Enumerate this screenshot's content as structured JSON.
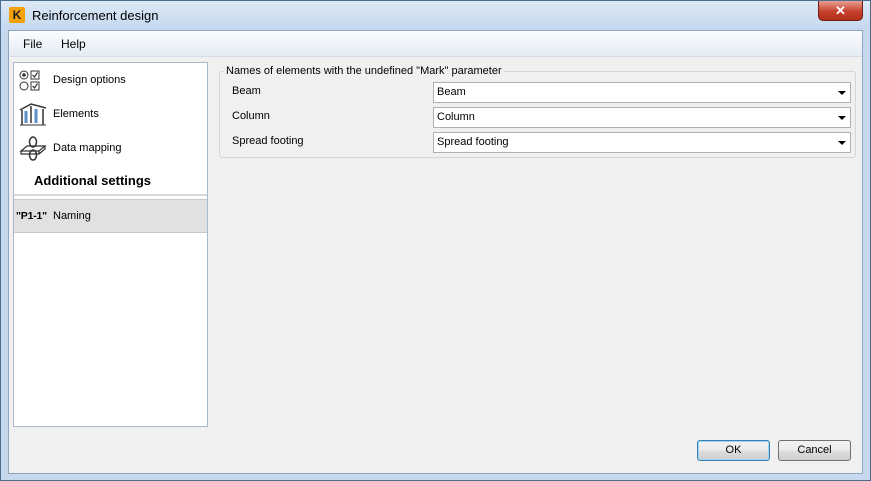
{
  "window": {
    "title": "Reinforcement design",
    "icon_letter": "K",
    "close_glyph": "✕"
  },
  "menu": [
    "File",
    "Help"
  ],
  "sidebar": {
    "items": [
      {
        "label": "Design options",
        "icon": "design-options-icon"
      },
      {
        "label": "Elements",
        "icon": "elements-icon"
      },
      {
        "label": "Data mapping",
        "icon": "data-mapping-icon"
      }
    ],
    "section_title": "Additional settings",
    "selected_item": {
      "badge": "\"P1-1\"",
      "label": "Naming"
    }
  },
  "group": {
    "legend": "Names of elements with the undefined \"Mark\" parameter",
    "rows": [
      {
        "label": "Beam",
        "value": "Beam"
      },
      {
        "label": "Column",
        "value": "Column"
      },
      {
        "label": "Spread footing",
        "value": "Spread footing"
      }
    ]
  },
  "buttons": {
    "ok": "OK",
    "cancel": "Cancel"
  }
}
